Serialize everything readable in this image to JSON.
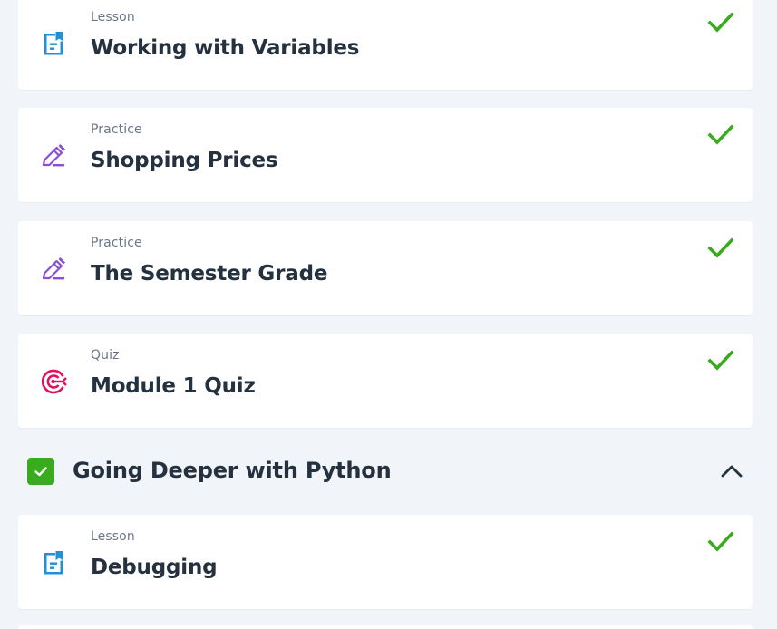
{
  "colors": {
    "check": "#3aab1e",
    "lesson_icon": "#1c92dd",
    "practice_icon": "#8a4fd6",
    "quiz_icon": "#e0115f",
    "title": "#25313f",
    "label": "#6b7789",
    "background": "#f1f4f8"
  },
  "items": [
    {
      "type_label": "Lesson",
      "title": "Working with Variables",
      "icon": "lesson-document-icon",
      "completed": true
    },
    {
      "type_label": "Practice",
      "title": "Shopping Prices",
      "icon": "practice-pencil-icon",
      "completed": true
    },
    {
      "type_label": "Practice",
      "title": "The Semester Grade",
      "icon": "practice-pencil-icon",
      "completed": true
    },
    {
      "type_label": "Quiz",
      "title": "Module 1 Quiz",
      "icon": "quiz-target-icon",
      "completed": true
    }
  ],
  "section": {
    "title": "Going Deeper with Python",
    "completed": true,
    "expanded": true,
    "items": [
      {
        "type_label": "Lesson",
        "title": "Debugging",
        "icon": "lesson-document-icon",
        "completed": true
      }
    ]
  }
}
